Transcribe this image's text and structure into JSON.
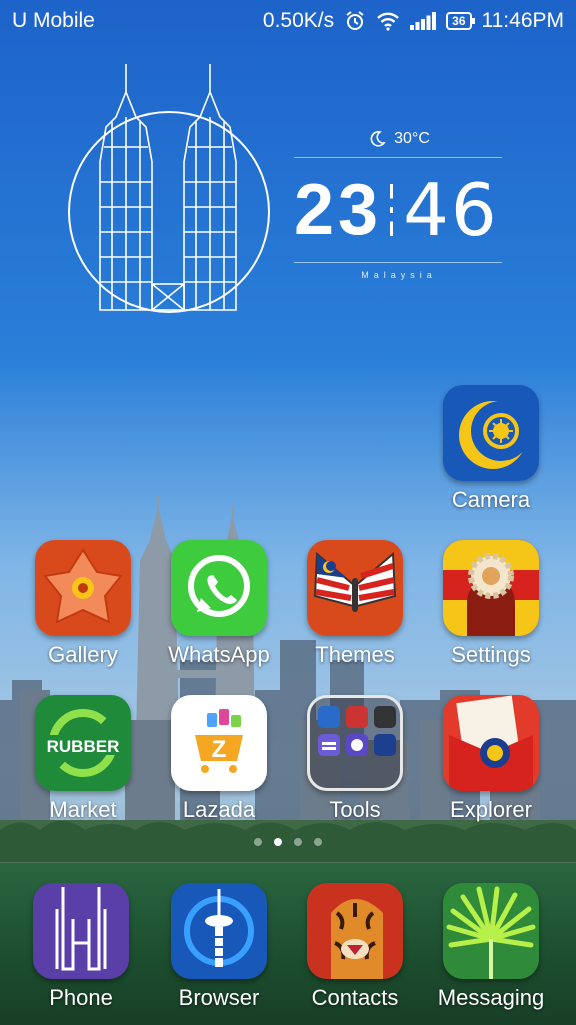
{
  "status_bar": {
    "carrier": "U Mobile",
    "net_speed": "0.50K/s",
    "battery": "36",
    "time": "11:46PM",
    "icons": [
      "alarm-icon",
      "wifi-icon",
      "signal-icon",
      "battery-icon"
    ]
  },
  "clock_widget": {
    "weather_icon": "moon-icon",
    "temperature": "30°C",
    "hours": "23",
    "minutes": "46",
    "location": "Malaysia"
  },
  "apps": {
    "camera": "Camera",
    "gallery": "Gallery",
    "whatsapp": "WhatsApp",
    "themes": "Themes",
    "settings": "Settings",
    "market": "Market",
    "market_badge": "RUBBER",
    "lazada": "Lazada",
    "tools": "Tools",
    "explorer": "Explorer"
  },
  "page_indicator": {
    "count": 4,
    "active": 2
  },
  "dock": {
    "phone": "Phone",
    "browser": "Browser",
    "contacts": "Contacts",
    "messaging": "Messaging"
  },
  "colors": {
    "sky": "#1f6fd0",
    "dock_green": "#1c4d2e",
    "whatsapp_green": "#3ecb3e",
    "flag_red": "#d6231e",
    "flag_yellow": "#f5c518"
  }
}
